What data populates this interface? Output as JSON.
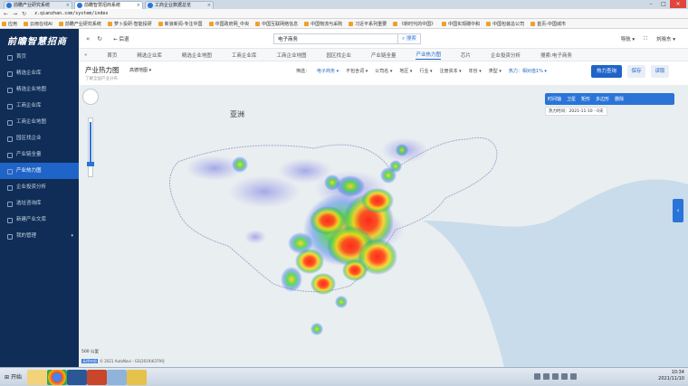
{
  "browser": {
    "tabs": [
      {
        "label": "前瞻产业研究系统",
        "active": false
      },
      {
        "label": "前瞻智慧招商系统",
        "active": true
      },
      {
        "label": "工商企业数据总览",
        "active": false
      }
    ],
    "url": "z.qianzhan.com/system/index",
    "bookmarks": [
      "应用",
      "云雨在线AI",
      "前瞻产业研究系统",
      "萝卜投研-智能投研",
      "新浪新闻-专注中国",
      "中国政府网_中央",
      "中国互联网络信息",
      "中国物流与采购",
      "习近平系列重要",
      "《新时代的中国》",
      "中国实现碳中和",
      "中国包装总公司",
      "首页-中国城市"
    ]
  },
  "app": {
    "logo": "前瞻智慧招商",
    "menu": [
      {
        "label": "首页",
        "active": false
      },
      {
        "label": "精选企业库",
        "active": false
      },
      {
        "label": "精选企业地图",
        "active": false
      },
      {
        "label": "工商企业库",
        "active": false
      },
      {
        "label": "工商企业地图",
        "active": false
      },
      {
        "label": "园区找企业",
        "active": false
      },
      {
        "label": "产业链全量",
        "active": false
      },
      {
        "label": "产业热力图",
        "active": true
      },
      {
        "label": "企业投资分析",
        "active": false
      },
      {
        "label": "选址咨询库",
        "active": false
      },
      {
        "label": "新建产业文库",
        "active": false
      },
      {
        "label": "我的管理",
        "active": false,
        "caret": "▾"
      }
    ],
    "topbar": {
      "back": "后退",
      "search_value": "电子商务",
      "search_button": "搜索",
      "nav": "导航 ▾",
      "user": "刘晓东 ▾"
    },
    "navtabs": [
      "首页",
      "精选企业库",
      "精选企业地图",
      "工商企业库",
      "工商企业地图",
      "园区找企业",
      "产业链全量",
      "产业热力图",
      "芯片",
      "企业投资分析",
      "搜索:电子商务"
    ],
    "active_navtab": "产业热力图",
    "panel": {
      "title": "产业热力图",
      "subtitle": "了解全国产业分布",
      "map_select": "高德地图 ▾",
      "filters": [
        "筛选：",
        "电子商务 ▾",
        "不包含词 ▾",
        "公司名 ▾",
        "地区 ▾",
        "行业 ▾",
        "注册资本 ▾",
        "年份 ▾",
        "类型 ▾",
        "热力：相对值1% ▾"
      ],
      "btn_query": "热力查询",
      "btn_save": "保存",
      "btn_read": "读取"
    },
    "map": {
      "label_asia": "亚洲",
      "toolbar": [
        "时间轴",
        "卫星",
        "矩形",
        "多边形",
        "删除"
      ],
      "date": "热力时间：2021-11-10  - 0天",
      "scale": "500 公里",
      "copyright": "© 2021 AutoNavi - GS(2019)6379号",
      "copy_tag": "高德地图",
      "side_button": "‹"
    }
  },
  "taskbar": {
    "start": "开始",
    "time": "10:34",
    "date": "2021/11/10"
  }
}
